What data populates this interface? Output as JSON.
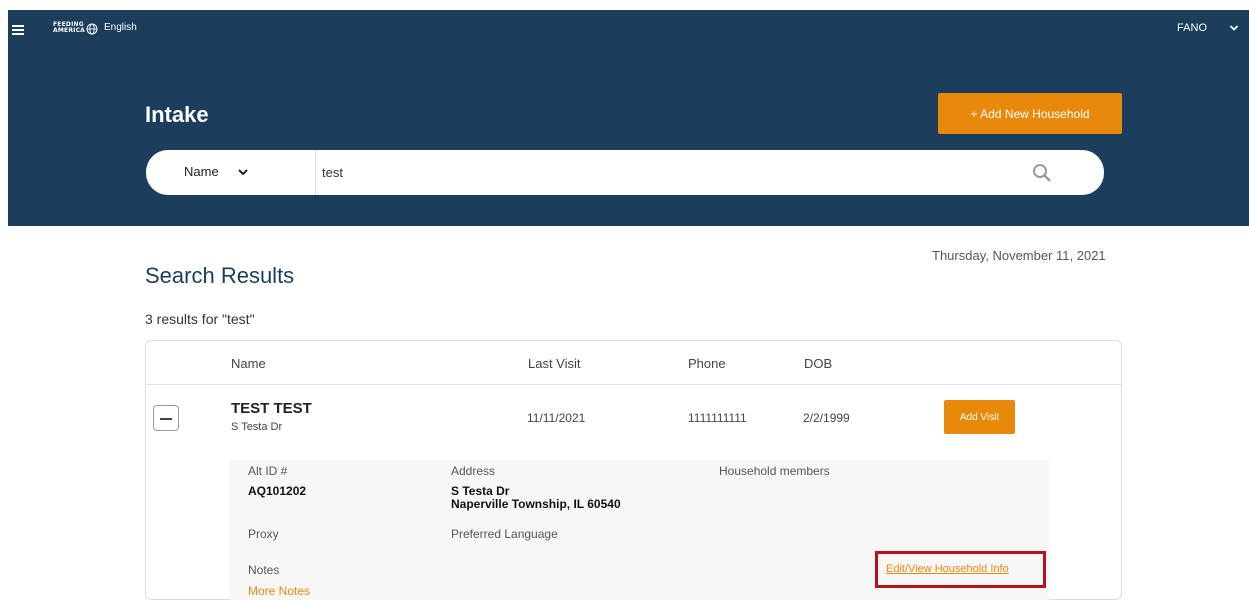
{
  "topbar": {
    "logo_line1": "FEEDING",
    "logo_line2": "AMERICA",
    "language": "English",
    "user": "FANO"
  },
  "page": {
    "title": "Intake",
    "add_household_label": "+ Add New Household"
  },
  "search": {
    "type_label": "Name",
    "value": "test"
  },
  "results": {
    "date": "Thursday, November 11, 2021",
    "heading": "Search Results",
    "count_text": "3 results for \"test\"",
    "columns": [
      "Name",
      "Last Visit",
      "Phone",
      "DOB"
    ],
    "row": {
      "name": "TEST TEST",
      "street": "S Testa Dr",
      "last_visit": "11/11/2021",
      "phone": "1111111111",
      "dob": "2/2/1999",
      "add_visit_label": "Add Visit"
    },
    "details": {
      "alt_id_label": "Alt ID #",
      "alt_id_value": "AQ101202",
      "address_label": "Address",
      "address_line1": "S Testa Dr",
      "address_line2": "Naperville Township, IL 60540",
      "household_members_label": "Household members",
      "proxy_label": "Proxy",
      "preferred_language_label": "Preferred Language",
      "notes_label": "Notes",
      "more_notes_label": "More Notes",
      "edit_link_label": "Edit/View Household Info"
    }
  },
  "colors": {
    "header_bg": "#1c3d5b",
    "accent": "#e8890c",
    "highlight": "#b5121b"
  }
}
